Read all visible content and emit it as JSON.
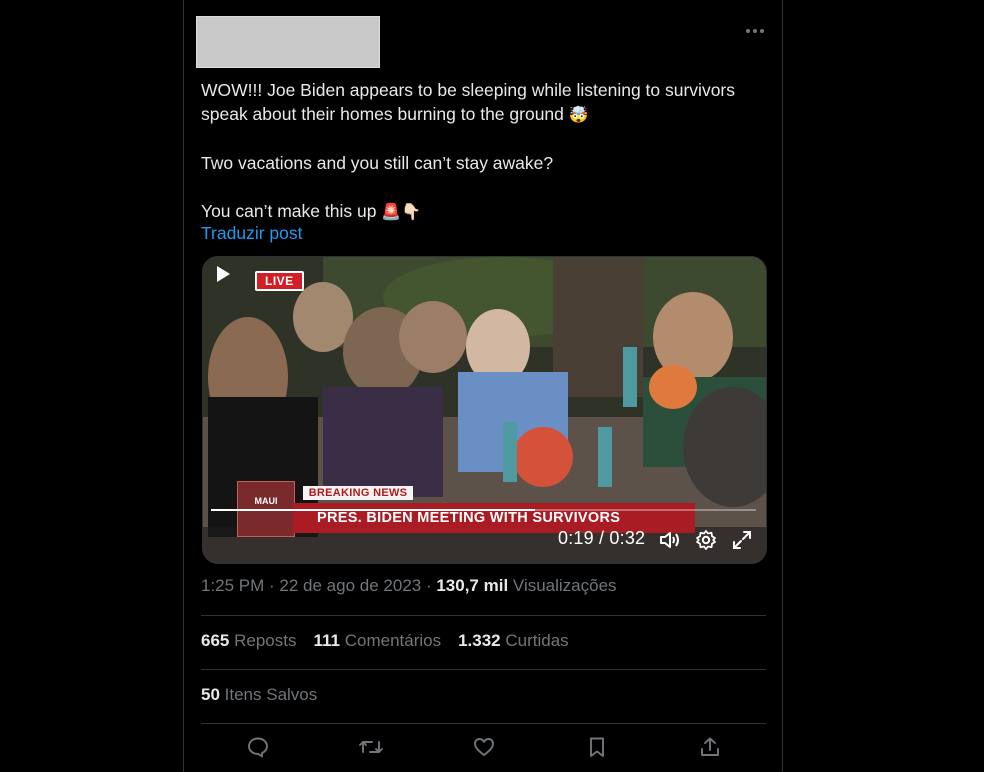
{
  "tweet": {
    "text_lines": [
      "WOW!!! Joe Biden appears to be sleeping while listening to survivors speak about their homes burning to the ground",
      "Two vacations and you still can’t stay awake?",
      "You can’t make this up"
    ],
    "emoji_line1": "🤯",
    "emoji_line3": "🚨👇🏻",
    "translate_label": "Traduzir post"
  },
  "video": {
    "live_label": "LIVE",
    "maui_label": "MAUI",
    "breaking_label": "BREAKING NEWS",
    "headline": "PRES. BIDEN MEETING WITH SURVIVORS",
    "time_display": "0:19 / 0:32",
    "progress_fraction": 0.594
  },
  "meta": {
    "time": "1:25 PM",
    "date": "22 de ago de 2023",
    "views_count": "130,7 mil",
    "views_label": "Visualizações"
  },
  "stats": {
    "reposts_count": "665",
    "reposts_label": "Reposts",
    "comments_count": "111",
    "comments_label": "Comentários",
    "likes_count": "1.332",
    "likes_label": "Curtidas",
    "saves_count": "50",
    "saves_label": "Itens Salvos"
  },
  "colors": {
    "background": "#000000",
    "text": "#e7e9ea",
    "muted": "#71767b",
    "link": "#1d9bf0",
    "border": "#2f3336"
  }
}
